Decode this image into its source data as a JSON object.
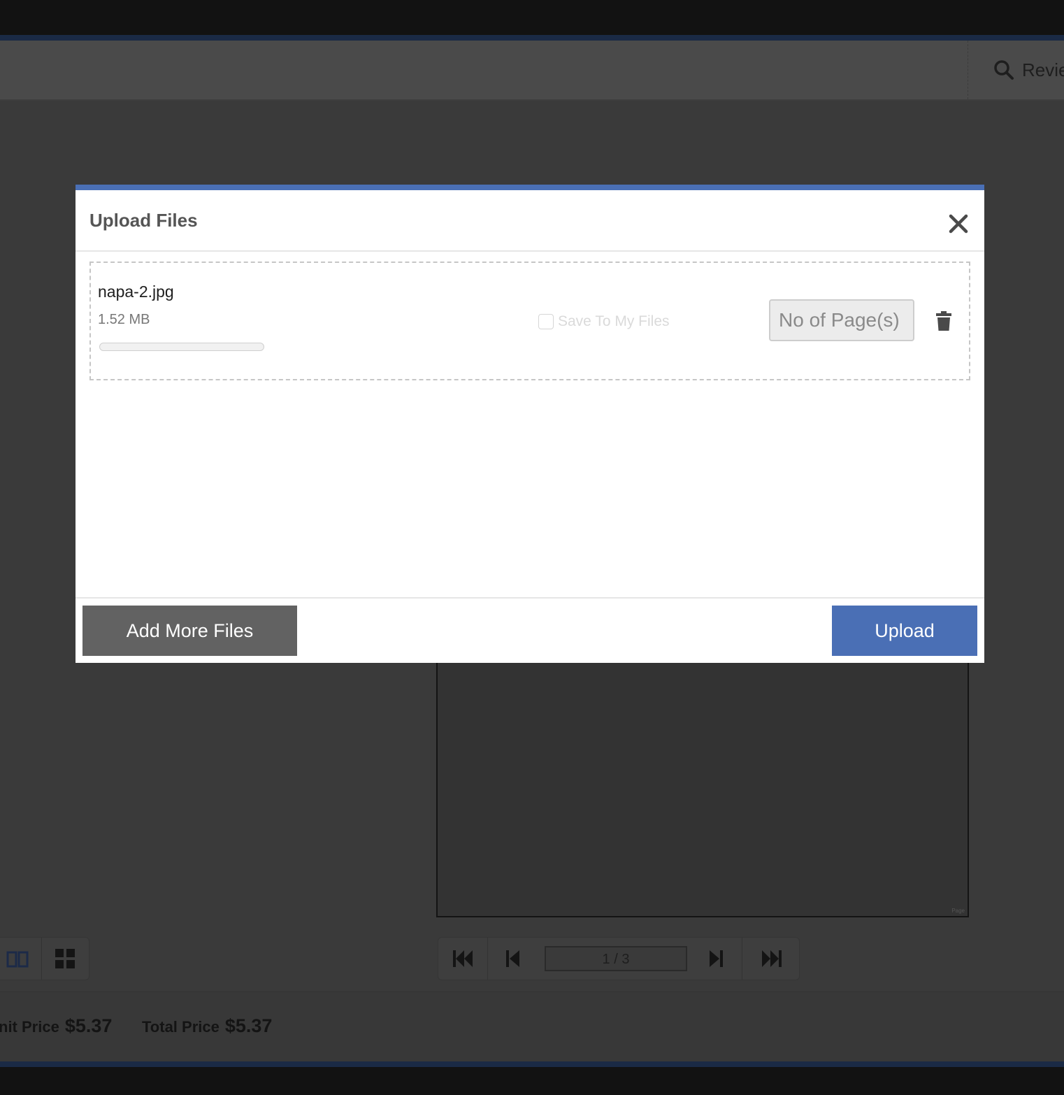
{
  "header": {
    "review_label": "Revie"
  },
  "background": {
    "page_counter": "1 / 3",
    "unit_price_label": "nit Price",
    "unit_price_value": "$5.37",
    "total_price_label": "Total Price",
    "total_price_value": "$5.37"
  },
  "modal": {
    "title": "Upload Files",
    "file": {
      "name": "napa-2.jpg",
      "size": "1.52 MB",
      "progress": 0.0,
      "save_to_my_files_label": "Save To My Files",
      "save_to_my_files_checked": false,
      "pages_placeholder": "No of Page(s)"
    },
    "add_more_label": "Add More Files",
    "upload_label": "Upload"
  },
  "colors": {
    "accent": "#4a6fb5",
    "secondary_button": "#626262",
    "overlay_dim": "#3a3a3a"
  },
  "icons": [
    "search-icon",
    "book-view-icon",
    "grid-view-icon",
    "first-page-icon",
    "previous-page-icon",
    "next-page-icon",
    "last-page-icon",
    "close-icon",
    "trash-icon"
  ]
}
